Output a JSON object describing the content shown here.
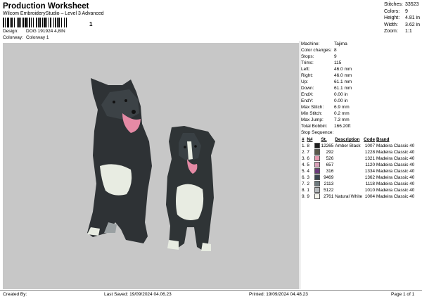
{
  "header": {
    "title": "Production Worksheet",
    "subtitle": "Wilcom EmbroideryStudio – Level 3 Advanced",
    "barcode_number": "1"
  },
  "info": {
    "design_label": "Design:",
    "design_value": "DOG 191924 4,8IN",
    "colorway_label": "Colorway:",
    "colorway_value": "Colorway 1"
  },
  "stats": [
    {
      "label": "Stitches:",
      "value": "33523"
    },
    {
      "label": "Colors:",
      "value": "9"
    },
    {
      "label": "Height:",
      "value": "4.81 in"
    },
    {
      "label": "Width:",
      "value": "3.62 in"
    },
    {
      "label": "Zoom:",
      "value": "1:1"
    }
  ],
  "machine": [
    {
      "label": "Machine:",
      "value": "Tajima"
    },
    {
      "label": "Color changes:",
      "value": "8"
    },
    {
      "label": "Stops:",
      "value": "9"
    },
    {
      "label": "Trims:",
      "value": "115"
    },
    {
      "label": "Left:",
      "value": "46.0 mm"
    },
    {
      "label": "Right:",
      "value": "46.0 mm"
    },
    {
      "label": "Up:",
      "value": "61.1 mm"
    },
    {
      "label": "Down:",
      "value": "61.1 mm"
    },
    {
      "label": "EndX:",
      "value": "0.00 in"
    },
    {
      "label": "EndY:",
      "value": "0.00 in"
    },
    {
      "label": "Max Stitch:",
      "value": "6.9 mm"
    },
    {
      "label": "Min Stitch:",
      "value": "0.2 mm"
    },
    {
      "label": "Max Jump:",
      "value": "7.3 mm"
    },
    {
      "label": "Total Bobbin:",
      "value": "166.20ft"
    }
  ],
  "sequence": {
    "title": "Stop Sequence:",
    "headers": [
      "#",
      "N#",
      "St.",
      "Description",
      "Code",
      "Brand"
    ],
    "rows": [
      {
        "stop": "1.",
        "n": "8",
        "color": "#1e1e1e",
        "st": "12265",
        "desc": "Amber Black",
        "code": "1007",
        "brand": "Madeira Classic 40"
      },
      {
        "stop": "2.",
        "n": "7",
        "color": "#5a5a4a",
        "st": "292",
        "desc": "",
        "code": "1228",
        "brand": "Madeira Classic 40"
      },
      {
        "stop": "3.",
        "n": "6",
        "color": "#e79ab0",
        "st": "526",
        "desc": "",
        "code": "1321",
        "brand": "Madeira Classic 40"
      },
      {
        "stop": "4.",
        "n": "5",
        "color": "#d9a1b9",
        "st": "657",
        "desc": "",
        "code": "1120",
        "brand": "Madeira Classic 40"
      },
      {
        "stop": "5.",
        "n": "4",
        "color": "#6a3a7a",
        "st": "316",
        "desc": "",
        "code": "1334",
        "brand": "Madeira Classic 40"
      },
      {
        "stop": "6.",
        "n": "3",
        "color": "#3a4650",
        "st": "9469",
        "desc": "",
        "code": "1362",
        "brand": "Madeira Classic 40"
      },
      {
        "stop": "7.",
        "n": "2",
        "color": "#6e7a7e",
        "st": "2113",
        "desc": "",
        "code": "1118",
        "brand": "Madeira Classic 40"
      },
      {
        "stop": "8.",
        "n": "1",
        "color": "#b5b9bc",
        "st": "5122",
        "desc": "",
        "code": "1010",
        "brand": "Madeira Classic 40"
      },
      {
        "stop": "9.",
        "n": "9",
        "color": "#f4f4ec",
        "st": "2761",
        "desc": "Natural White",
        "code": "1004",
        "brand": "Madeira Classic 40"
      }
    ]
  },
  "footer": {
    "created_by": "Created By:",
    "last_saved": "Last Saved: 19/09/2024 04.06.23",
    "printed": "Printed: 19/09/2024 04.48.23",
    "page": "Page 1 of 1"
  },
  "colors": {
    "canvas_bg": "#c7c7c7"
  }
}
